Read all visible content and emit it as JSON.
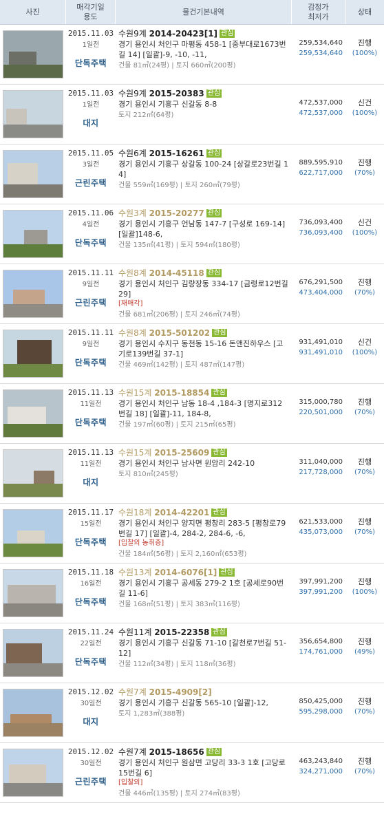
{
  "header": {
    "photo": "사진",
    "date_l1": "매각기일",
    "date_l2": "용도",
    "desc": "물건기본내역",
    "price_l1": "감정가",
    "price_l2": "최저가",
    "status": "상태"
  },
  "rows": [
    {
      "date": "2015.11.03",
      "days": "1일전",
      "usage": "단독주택",
      "court": "수원9계",
      "caseno": "2014-20423[1]",
      "tag": "관심",
      "done": false,
      "addr": "경기 용인시 처인구 마평동 458-1 [중부대로1673번길 14] [일괄]-9, -10, -11,",
      "note": "",
      "area": "건물 81㎡(24평) | 토지 660㎡(200평)",
      "appraisal": "259,534,640",
      "minimum": "259,534,640",
      "status": "진행",
      "pct": "(100%)"
    },
    {
      "date": "2015.11.03",
      "days": "1일전",
      "usage": "대지",
      "court": "수원9계",
      "caseno": "2015-20383",
      "tag": "관심",
      "done": false,
      "addr": "경기 용인시 기흥구 신갈동 8-8",
      "note": "",
      "area": "토지 212㎡(64평)",
      "appraisal": "472,537,000",
      "minimum": "472,537,000",
      "status": "신건",
      "pct": "(100%)"
    },
    {
      "date": "2015.11.05",
      "days": "3일전",
      "usage": "근린주택",
      "court": "수원6계",
      "caseno": "2015-16261",
      "tag": "관심",
      "done": false,
      "addr": "경기 용인시 기흥구 상갈동 100-24 [상갈로23번길 14]",
      "note": "",
      "area": "건물 559㎡(169평) | 토지 260㎡(79평)",
      "appraisal": "889,595,910",
      "minimum": "622,717,000",
      "status": "진행",
      "pct": "(70%)"
    },
    {
      "date": "2015.11.06",
      "days": "4일전",
      "usage": "단독주택",
      "court": "수원3계",
      "caseno": "2015-20277",
      "tag": "관심",
      "done": true,
      "addr": "경기 용인시 기흥구 언남동 147-7 [구성로 169-14] [일괄]148-6,",
      "note": "",
      "area": "건물 135㎡(41평) | 토지 594㎡(180평)",
      "appraisal": "736,093,400",
      "minimum": "736,093,400",
      "status": "신건",
      "pct": "(100%)"
    },
    {
      "date": "2015.11.11",
      "days": "9일전",
      "usage": "근린주택",
      "court": "수원8계",
      "caseno": "2014-45118",
      "tag": "관심",
      "done": true,
      "addr": "경기 용인시 처인구 김량장동 334-17 [금령로12번길 29]",
      "note": "[재매각]",
      "area": "건물 681㎡(206평) | 토지 246㎡(74평)",
      "appraisal": "676,291,500",
      "minimum": "473,404,000",
      "status": "진행",
      "pct": "(70%)"
    },
    {
      "date": "2015.11.11",
      "days": "9일전",
      "usage": "단독주택",
      "court": "수원8계",
      "caseno": "2015-501202",
      "tag": "관심",
      "done": true,
      "addr": "경기 용인시 수지구 동천동 15-16 돈앤진하우스 [고기로139번길 37-1]",
      "note": "",
      "area": "건물 469㎡(142평) | 토지 487㎡(147평)",
      "appraisal": "931,491,010",
      "minimum": "931,491,010",
      "status": "신건",
      "pct": "(100%)"
    },
    {
      "date": "2015.11.13",
      "days": "11일전",
      "usage": "단독주택",
      "court": "수원15계",
      "caseno": "2015-18854",
      "tag": "관심",
      "done": true,
      "addr": "경기 용인시 처인구 남동 18-4 ,184-3 [명지로312번길 18] [일괄]-11, 184-8,",
      "note": "",
      "area": "건물 197㎡(60평) | 토지 215㎡(65평)",
      "appraisal": "315,000,780",
      "minimum": "220,501,000",
      "status": "진행",
      "pct": "(70%)"
    },
    {
      "date": "2015.11.13",
      "days": "11일전",
      "usage": "대지",
      "court": "수원15계",
      "caseno": "2015-25609",
      "tag": "관심",
      "done": true,
      "addr": "경기 용인시 처인구 남사면 원암리 242-10",
      "note": "",
      "area": "토지 810㎡(245평)",
      "appraisal": "311,040,000",
      "minimum": "217,728,000",
      "status": "진행",
      "pct": "(70%)"
    },
    {
      "date": "2015.11.17",
      "days": "15일전",
      "usage": "단독주택",
      "court": "수원18계",
      "caseno": "2014-42201",
      "tag": "관심",
      "done": true,
      "addr": "경기 용인시 처인구 양지면 평창리 283-5 [평창로79번길 17] [일괄]-4, 284-2, 284-6, -6,",
      "note": "[입찰외 농취증]",
      "area": "건물 184㎡(56평) | 토지 2,160㎡(653평)",
      "appraisal": "621,533,000",
      "minimum": "435,073,000",
      "status": "진행",
      "pct": "(70%)"
    },
    {
      "date": "2015.11.18",
      "days": "16일전",
      "usage": "단독주택",
      "court": "수원13계",
      "caseno": "2014-6076[1]",
      "tag": "관심",
      "done": true,
      "addr": "경기 용인시 기흥구 공세동 279-2 1호 [공세로90번길 11-6]",
      "note": "",
      "area": "건물 168㎡(51평) | 토지 383㎡(116평)",
      "appraisal": "397,991,200",
      "minimum": "397,991,200",
      "status": "진행",
      "pct": "(100%)"
    },
    {
      "date": "2015.11.24",
      "days": "22일전",
      "usage": "단독주택",
      "court": "수원11계",
      "caseno": "2015-22358",
      "tag": "관심",
      "done": false,
      "addr": "경기 용인시 기흥구 신갈동 71-10 [갈천로7번길 51-12]",
      "note": "",
      "area": "건물 112㎡(34평) | 토지 118㎡(36평)",
      "appraisal": "356,654,800",
      "minimum": "174,761,000",
      "status": "진행",
      "pct": "(49%)"
    },
    {
      "date": "2015.12.02",
      "days": "30일전",
      "usage": "대지",
      "court": "수원7계",
      "caseno": "2015-4909[2]",
      "tag": "",
      "done": true,
      "addr": "경기 용인시 기흥구 신갈동 565-10 [일괄]-12,",
      "note": "",
      "area": "토지 1,283㎡(388평)",
      "appraisal": "850,425,000",
      "minimum": "595,298,000",
      "status": "진행",
      "pct": "(70%)"
    },
    {
      "date": "2015.12.02",
      "days": "30일전",
      "usage": "근린주택",
      "court": "수원7계",
      "caseno": "2015-18656",
      "tag": "관심",
      "done": false,
      "addr": "경기 용인시 처인구 원삼면 고당리 33-3 1호 [고당로15번길 6]",
      "note": "[입찰외]",
      "area": "건물 446㎡(135평) | 토지 274㎡(83평)",
      "appraisal": "463,243,840",
      "minimum": "324,271,000",
      "status": "진행",
      "pct": "(70%)"
    }
  ],
  "thumb_colors": [
    {
      "sky": "#9aa7ad",
      "bld": "#6b6f66",
      "ground": "#5d6a4a"
    },
    {
      "sky": "#c8d6e0",
      "bld": "#c9c4bb",
      "ground": "#8a8a86"
    },
    {
      "sky": "#b9cfe6",
      "bld": "#d7d2c8",
      "ground": "#7d7a72"
    },
    {
      "sky": "#bcd3ea",
      "bld": "#9c9a92",
      "ground": "#5e7e3e"
    },
    {
      "sky": "#a9c6e8",
      "bld": "#c4a48a",
      "ground": "#8f8c86"
    },
    {
      "sky": "#c7d7e2",
      "bld": "#5a4636",
      "ground": "#6f8a45"
    },
    {
      "sky": "#b8c4cc",
      "bld": "#e4e1dc",
      "ground": "#5f7a3a"
    },
    {
      "sky": "#d5dde2",
      "bld": "#8c7a66",
      "ground": "#7a8a4e"
    },
    {
      "sky": "#b3cde6",
      "bld": "#d9d3c8",
      "ground": "#6c8a40"
    },
    {
      "sky": "#c9d8e6",
      "bld": "#b9b4ad",
      "ground": "#8a8680"
    },
    {
      "sky": "#bdd0e2",
      "bld": "#7d6552",
      "ground": "#8c8882"
    },
    {
      "sky": "#a8c2de",
      "bld": "#b08a66",
      "ground": "#9a8262"
    },
    {
      "sky": "#bfd4e8",
      "bld": "#d3cbbd",
      "ground": "#8a8884"
    }
  ]
}
